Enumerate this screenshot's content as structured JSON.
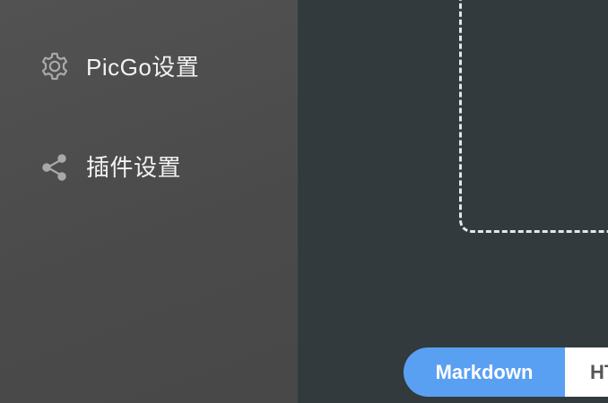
{
  "sidebar": {
    "items": [
      {
        "label": "PicGo设置",
        "icon": "gear-icon"
      },
      {
        "label": "插件设置",
        "icon": "share-icon"
      }
    ]
  },
  "main": {
    "format_options": [
      {
        "label": "Markdown",
        "active": true
      },
      {
        "label": "HT",
        "active": false
      }
    ]
  },
  "colors": {
    "sidebar_bg": "#4d4d4d",
    "main_bg": "#323a3d",
    "accent": "#5aa0f2",
    "dash_border": "#e6e6e6"
  }
}
